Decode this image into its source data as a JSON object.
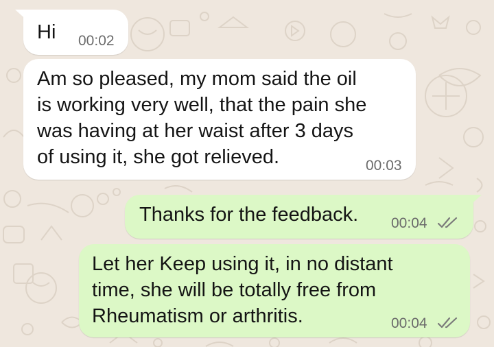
{
  "chat": {
    "messages": [
      {
        "direction": "incoming",
        "text": "Hi",
        "time": "00:02"
      },
      {
        "direction": "incoming",
        "text": "Am so pleased, my mom said the oil\nis working very well, that the pain she\nwas having at her waist after 3 days\nof using it, she got relieved.",
        "time": "00:03"
      },
      {
        "direction": "outgoing",
        "text": "Thanks for the feedback.",
        "time": "00:04",
        "status": "read"
      },
      {
        "direction": "outgoing",
        "text": "Let her Keep using it, in no distant\ntime, she will be totally free from\nRheumatism or arthritis.",
        "time": "00:04",
        "status": "read"
      }
    ]
  },
  "colors": {
    "wallpaper": "#efe7de",
    "incoming_bubble": "#ffffff",
    "outgoing_bubble": "#dcf8c6",
    "text": "#141414",
    "timestamp": "#6b6b6b",
    "ticks": "#7a7a7a"
  },
  "icons": {
    "delivery_status": "double-check-icon",
    "wallpaper": "doodle-pattern"
  }
}
